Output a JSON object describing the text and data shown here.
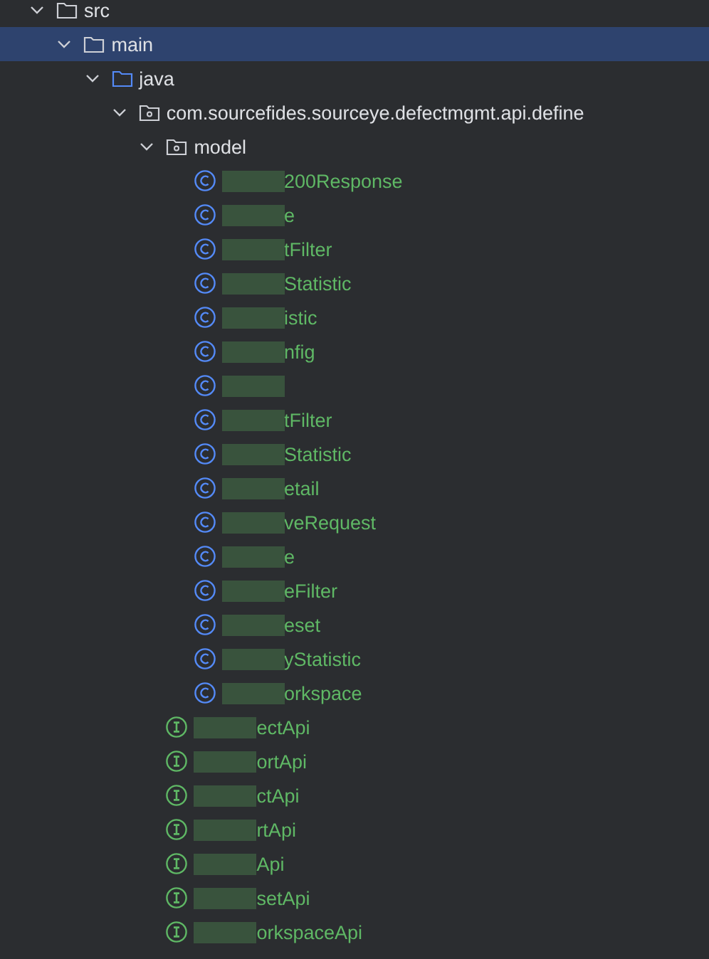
{
  "project_tree": [
    {
      "kind": "folder",
      "name": "src",
      "expanded": true,
      "selected": false,
      "children": [
        {
          "kind": "folder",
          "name": "main",
          "expanded": true,
          "selected": true,
          "children": [
            {
              "kind": "source-folder",
              "name": "java",
              "expanded": true,
              "selected": false,
              "children": [
                {
                  "kind": "package",
                  "name": "com.sourcefides.sourceye.defectmgmt.api.define",
                  "expanded": true,
                  "selected": false,
                  "children": [
                    {
                      "kind": "package",
                      "name": "model",
                      "expanded": true,
                      "selected": false,
                      "children": [
                        {
                          "kind": "class",
                          "name": "200Response",
                          "redacted": true,
                          "selected": false
                        },
                        {
                          "kind": "class",
                          "name": "e",
                          "redacted": true,
                          "selected": false
                        },
                        {
                          "kind": "class",
                          "name": "tFilter",
                          "redacted": true,
                          "selected": false
                        },
                        {
                          "kind": "class",
                          "name": "Statistic",
                          "redacted": true,
                          "selected": false
                        },
                        {
                          "kind": "class",
                          "name": "istic",
                          "redacted": true,
                          "selected": false
                        },
                        {
                          "kind": "class",
                          "name": "nfig",
                          "redacted": true,
                          "selected": false
                        },
                        {
                          "kind": "class",
                          "redacted": true,
                          "selected": false
                        },
                        {
                          "kind": "class",
                          "name": "tFilter",
                          "redacted": true,
                          "selected": false
                        },
                        {
                          "kind": "class",
                          "name": "Statistic",
                          "redacted": true,
                          "selected": false
                        },
                        {
                          "kind": "class",
                          "name": "etail",
                          "redacted": true,
                          "selected": false
                        },
                        {
                          "kind": "class",
                          "name": "veRequest",
                          "redacted": true,
                          "selected": false
                        },
                        {
                          "kind": "class",
                          "name": "e",
                          "redacted": true,
                          "selected": false
                        },
                        {
                          "kind": "class",
                          "name": "eFilter",
                          "redacted": true,
                          "selected": false
                        },
                        {
                          "kind": "class",
                          "name": "eset",
                          "redacted": true,
                          "selected": false
                        },
                        {
                          "kind": "class",
                          "name": "yStatistic",
                          "redacted": true,
                          "selected": false
                        },
                        {
                          "kind": "class",
                          "name": "orkspace",
                          "redacted": true,
                          "selected": false
                        }
                      ]
                    },
                    {
                      "kind": "interface",
                      "name": "ectApi",
                      "redacted": true,
                      "selected": false
                    },
                    {
                      "kind": "interface",
                      "name": "ortApi",
                      "redacted": true,
                      "selected": false
                    },
                    {
                      "kind": "interface",
                      "name": "ctApi",
                      "redacted": true,
                      "selected": false
                    },
                    {
                      "kind": "interface",
                      "name": "rtApi",
                      "redacted": true,
                      "selected": false
                    },
                    {
                      "kind": "interface",
                      "name": "Api",
                      "redacted": true,
                      "selected": false
                    },
                    {
                      "kind": "interface",
                      "name": "setApi",
                      "redacted": true,
                      "selected": false
                    },
                    {
                      "kind": "interface",
                      "name": "orkspaceApi",
                      "redacted": true,
                      "selected": false
                    }
                  ]
                }
              ]
            }
          ]
        }
      ]
    }
  ]
}
